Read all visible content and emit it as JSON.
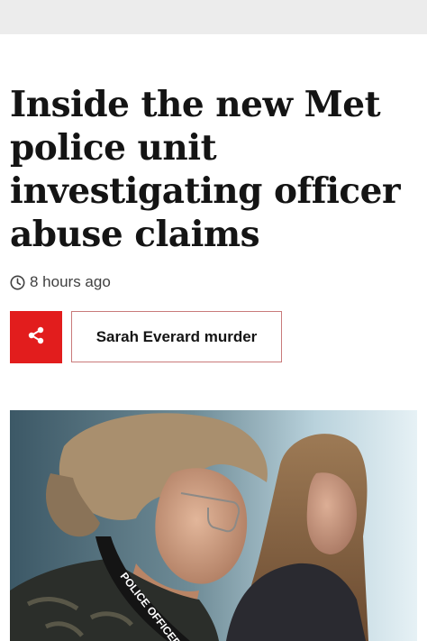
{
  "article": {
    "headline": "Inside the new Met police unit investigating officer abuse claims",
    "timestamp": "8 hours ago",
    "topic_label": "Sarah Everard murder"
  },
  "hero_image": {
    "lanyard_text": "POLICE OFFICER"
  },
  "colors": {
    "accent": "#e21d1d",
    "topic_border": "#c97a7a",
    "top_bar": "#ececec"
  },
  "icons": {
    "timestamp": "clock-icon",
    "share": "share-icon"
  }
}
